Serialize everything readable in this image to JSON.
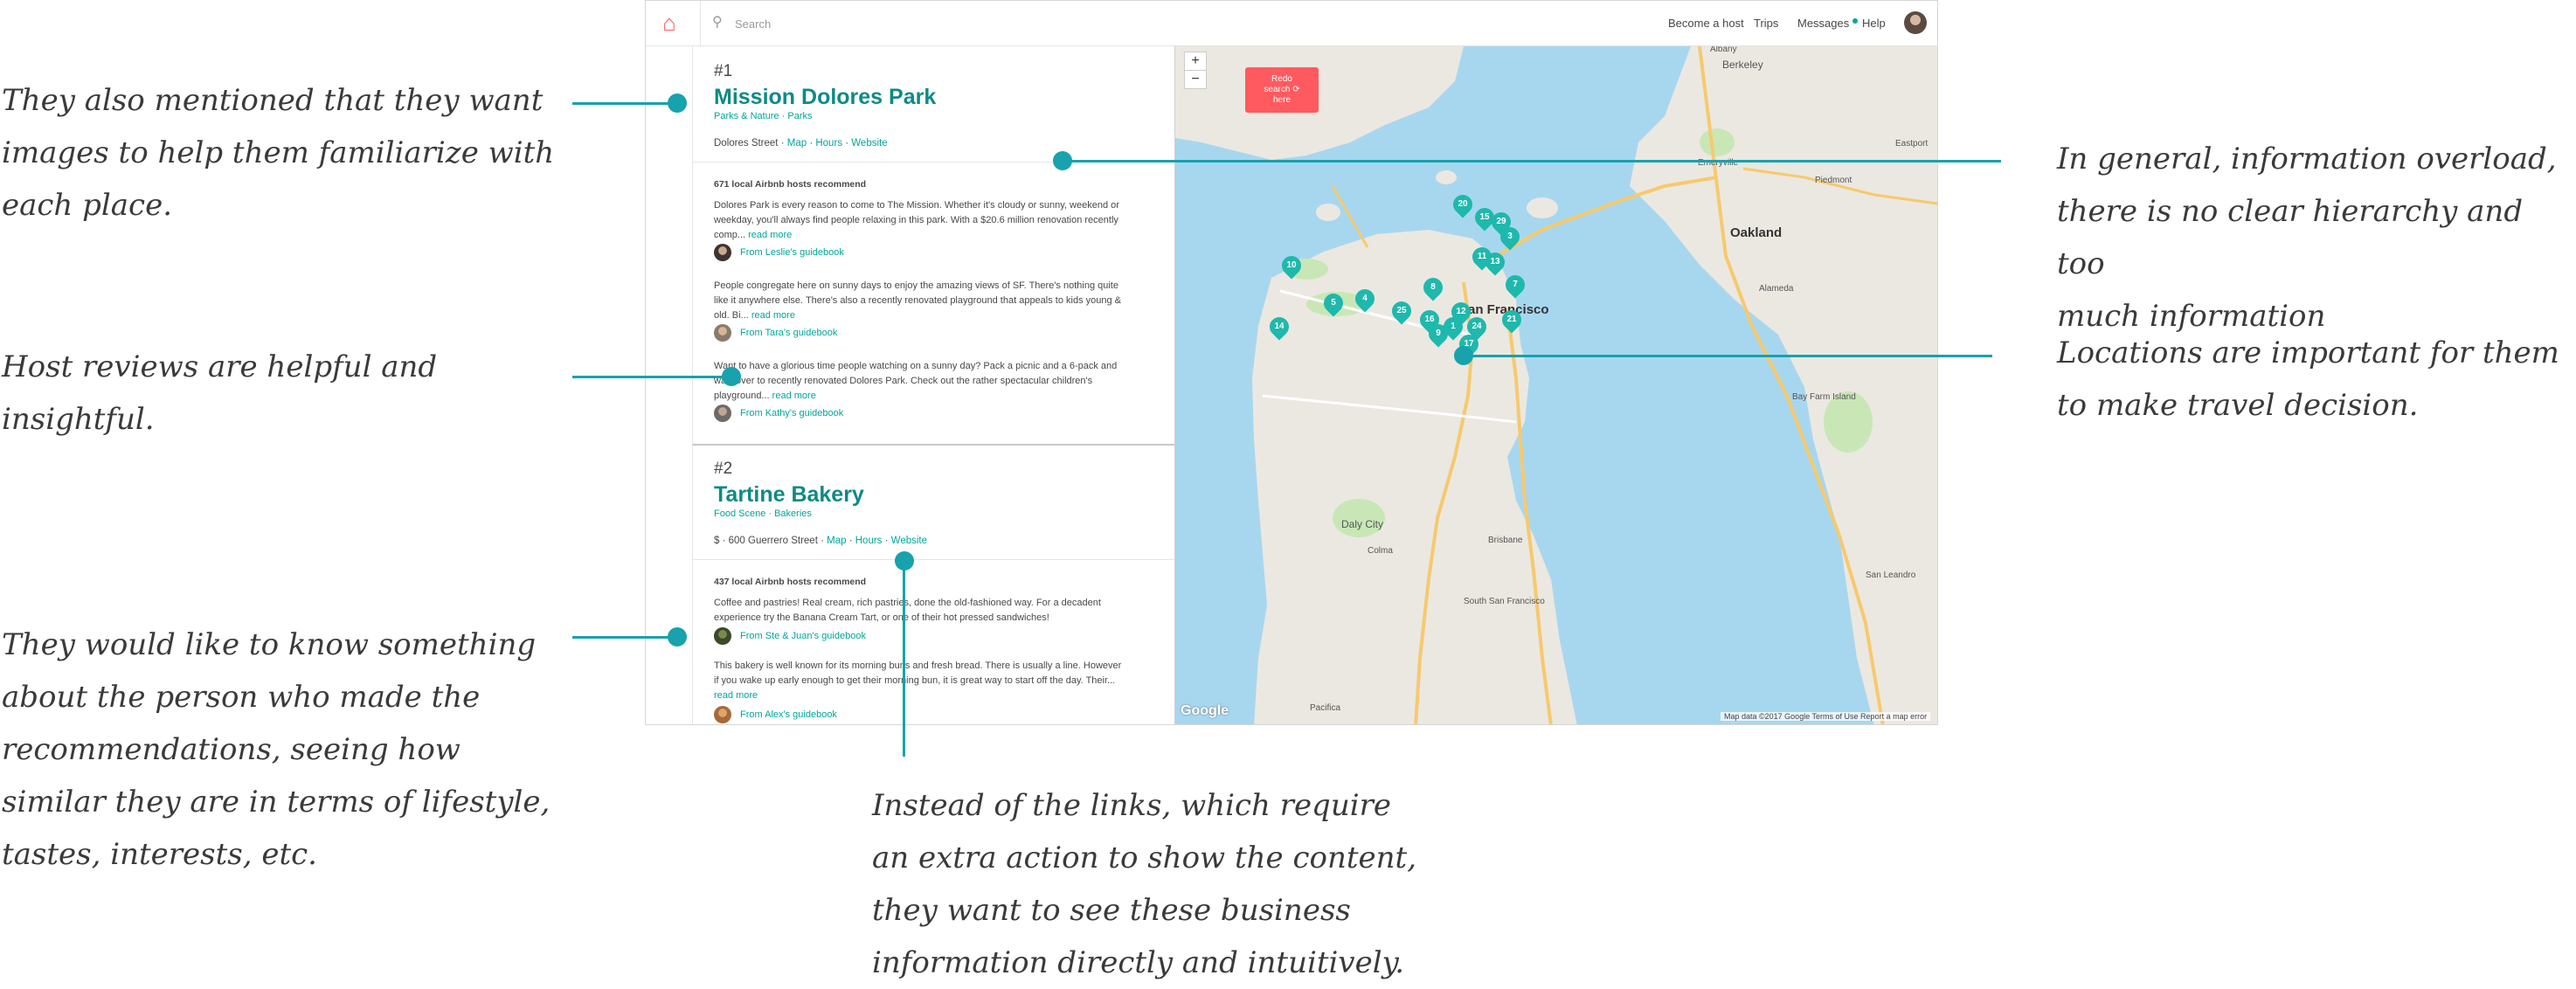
{
  "annotations": {
    "images": [
      "They also mentioned that they want",
      "images to help them familiarize with",
      "each place."
    ],
    "host_reviews": [
      "Host reviews are helpful and",
      "insightful."
    ],
    "person": [
      "They would like to know something",
      "about the person who made the",
      "recommendations, seeing how",
      "similar they are in terms of lifestyle,",
      "tastes, interests, etc."
    ],
    "overload": [
      "In general, information overload,",
      "there is no clear hierarchy and too",
      "much information"
    ],
    "locations": [
      "Locations are important for them",
      "to make travel decision."
    ],
    "links": [
      "Instead of the links, which require",
      "an extra action to show the content,",
      "they want to see these business",
      "information directly and intuitively."
    ]
  },
  "app": {
    "logo_glyph": "⌂",
    "search_placeholder": "Search",
    "nav": {
      "become_host": "Become a host",
      "trips": "Trips",
      "messages": "Messages",
      "help": "Help"
    }
  },
  "places": [
    {
      "rank": "#1",
      "name": "Mission Dolores Park",
      "tags": "Parks & Nature · Parks",
      "address": "Dolores Street",
      "links": [
        "Map",
        "Hours",
        "Website"
      ],
      "hosts_recommend": "671 local Airbnb hosts recommend",
      "reviews": [
        {
          "text": "Dolores Park is every reason to come to The Mission. Whether it's cloudy or sunny, weekend or weekday, you'll always find people relaxing in this park. With a $20.6 million renovation recently comp...",
          "more": "read more",
          "guidebook": "From Leslie's guidebook"
        },
        {
          "text": "People congregate here on sunny days to enjoy the amazing views of SF. There's nothing quite like it anywhere else. There's also a recently renovated playground that appeals to kids young & old. Bi...",
          "more": "read more",
          "guidebook": "From Tara's guidebook"
        },
        {
          "text": "Want to have a glorious time people watching on a sunny day? Pack a picnic and a 6-pack and walk over to recently renovated Dolores Park. Check out the rather spectacular children's playground...",
          "more": "read more",
          "guidebook": "From Kathy's guidebook"
        }
      ]
    },
    {
      "rank": "#2",
      "name": "Tartine Bakery",
      "tags": "Food Scene · Bakeries",
      "address": "$ · 600 Guerrero Street",
      "links": [
        "Map",
        "Hours",
        "Website"
      ],
      "hosts_recommend": "437 local Airbnb hosts recommend",
      "reviews": [
        {
          "text": "Coffee and pastries! Real cream, rich pastries, done the old-fashioned way. For a decadent experience try the Banana Cream Tart, or one of their hot pressed sandwiches!",
          "more": "",
          "guidebook": "From Ste & Juan's guidebook"
        },
        {
          "text": "This bakery is well known for its morning buns and fresh bread. There is usually a line. However if you wake up early enough to get their morning bun, it is great way to start off the day. Their...",
          "more": "read more",
          "guidebook": "From Alex's guidebook"
        }
      ]
    }
  ],
  "map": {
    "zoom_in": "+",
    "zoom_out": "−",
    "redo_lines": [
      "Redo",
      "search",
      "here"
    ],
    "redo_icon": "⟳",
    "google": "Google",
    "attribution": "Map data ©2017 Google   Terms of Use   Report a map error",
    "labels": {
      "berkeley": "Berkeley",
      "oakland": "Oakland",
      "sanfrancisco": "San Francisco",
      "dalycity": "Daly City",
      "alameda": "Alameda",
      "emeryville": "Emeryville",
      "piedmont": "Piedmont",
      "albany": "Albany",
      "colma": "Colma",
      "brisbane": "Brisbane",
      "southsf": "South San Francisco",
      "pacifica": "Pacifica",
      "eastport": "Eastport",
      "sanleandro": "San Leandro",
      "bayfarm": "Bay Farm Island"
    },
    "pins": [
      "20",
      "15",
      "29",
      "3",
      "11",
      "13",
      "10",
      "7",
      "8",
      "5",
      "4",
      "25",
      "1",
      "12",
      "24",
      "17",
      "21",
      "14",
      "9",
      "16"
    ],
    "colors": {
      "water": "#a7d7ef",
      "land": "#ebe8e1",
      "pin": "#1fb8ad",
      "highway": "#f7c96e"
    }
  },
  "colors": {
    "accent": "#17a2ad",
    "brand": "#ff5a5f",
    "teal_text": "#0e8a86"
  }
}
